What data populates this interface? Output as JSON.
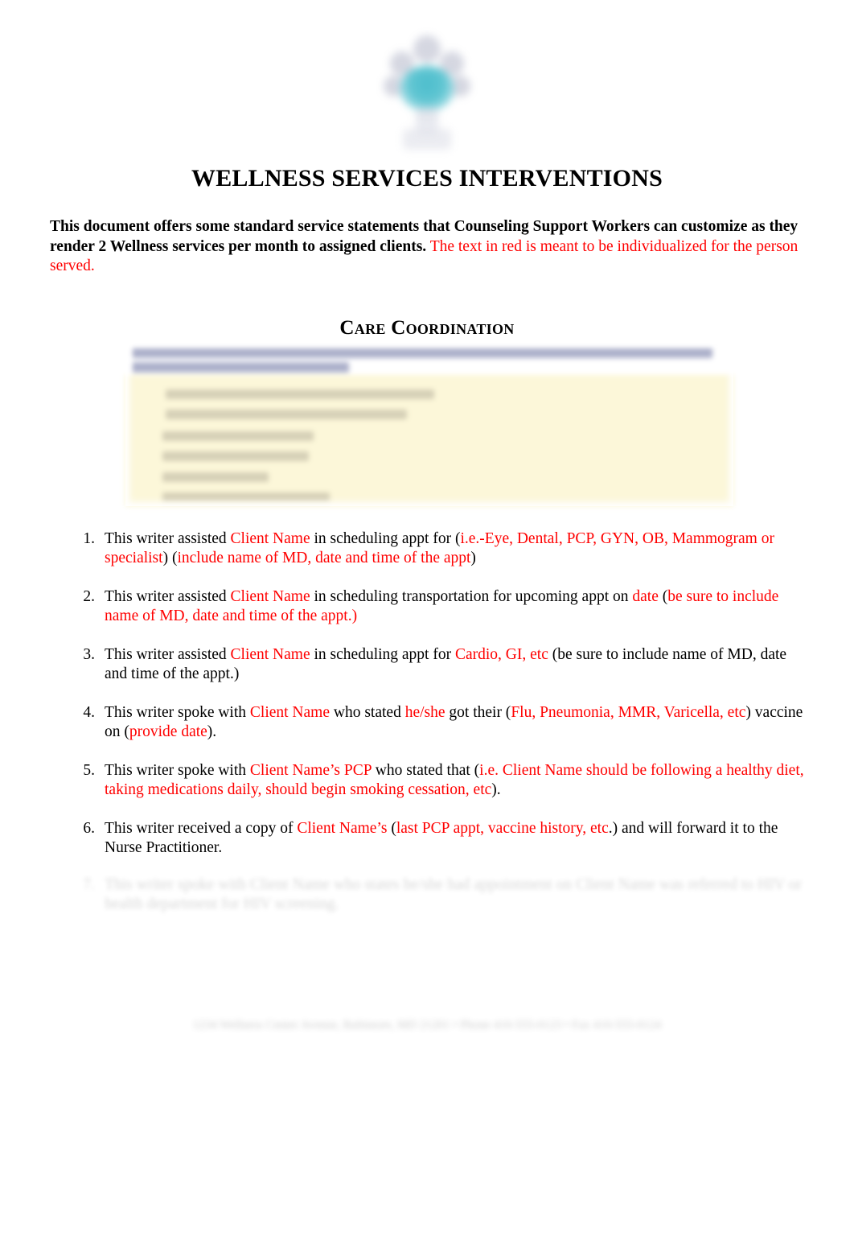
{
  "document": {
    "title": "WELLNESS SERVICES INTERVENTIONS",
    "logo_alt": "agency-logo",
    "intro": {
      "bold_black": "This document offers some standard service statements that Counseling Support Workers can customize as they render 2 Wellness services per month to assigned clients.",
      "red": "The text in red is meant to be individualized for the person served."
    },
    "section_heading": "Care Coordination",
    "callout": {
      "state": "redacted",
      "background_color": "#fcf7d9",
      "header_band_color": "#9ba0c0",
      "text": ""
    },
    "list": [
      {
        "number": "1.",
        "segments": [
          {
            "text": "This writer assisted ",
            "color": "black"
          },
          {
            "text": "Client Name",
            "color": "red"
          },
          {
            "text": " in scheduling appt for (",
            "color": "black"
          },
          {
            "text": "i.e.-Eye, Dental, PCP, GYN, OB, Mammogram or specialist",
            "color": "red"
          },
          {
            "text": ") (",
            "color": "black"
          },
          {
            "text": "include name of MD, date and time of the appt",
            "color": "red"
          },
          {
            "text": ")",
            "color": "black"
          }
        ]
      },
      {
        "number": "2.",
        "segments": [
          {
            "text": "This writer assisted ",
            "color": "black"
          },
          {
            "text": "Client Name",
            "color": "red"
          },
          {
            "text": " in scheduling transportation for upcoming appt on ",
            "color": "black"
          },
          {
            "text": "date",
            "color": "red"
          },
          {
            "text": " (",
            "color": "black"
          },
          {
            "text": "be sure to include name of MD, date and time of the appt.)",
            "color": "red"
          }
        ]
      },
      {
        "number": "3.",
        "segments": [
          {
            "text": "This writer assisted ",
            "color": "black"
          },
          {
            "text": "Client Name",
            "color": "red"
          },
          {
            "text": " in scheduling appt for ",
            "color": "black"
          },
          {
            "text": "Cardio, GI, etc",
            "color": "red"
          },
          {
            "text": " (be sure to include name of MD, date and time of the appt.)",
            "color": "black"
          }
        ]
      },
      {
        "number": "4.",
        "segments": [
          {
            "text": "This writer spoke with ",
            "color": "black"
          },
          {
            "text": "Client Name",
            "color": "red"
          },
          {
            "text": " who stated ",
            "color": "black"
          },
          {
            "text": "he/she",
            "color": "red"
          },
          {
            "text": " got their (",
            "color": "black"
          },
          {
            "text": "Flu, Pneumonia, MMR, Varicella, etc",
            "color": "red"
          },
          {
            "text": ") vaccine on (",
            "color": "black"
          },
          {
            "text": "provide date",
            "color": "red"
          },
          {
            "text": ").",
            "color": "black"
          }
        ]
      },
      {
        "number": "5.",
        "segments": [
          {
            "text": "This writer spoke with ",
            "color": "black"
          },
          {
            "text": "Client Name’s PCP",
            "color": "red"
          },
          {
            "text": " who stated that (",
            "color": "black"
          },
          {
            "text": "i.e. Client Name should be following a healthy diet, taking medications daily, should begin smoking cessation, etc",
            "color": "red"
          },
          {
            "text": ").",
            "color": "black"
          }
        ]
      },
      {
        "number": "6.",
        "segments": [
          {
            "text": "This writer received a copy of ",
            "color": "black"
          },
          {
            "text": "Client Name’s",
            "color": "red"
          },
          {
            "text": " (",
            "color": "black"
          },
          {
            "text": "last PCP appt, vaccine history, etc",
            "color": "red"
          },
          {
            "text": ".) and will forward it to the Nurse Practitioner.",
            "color": "black"
          }
        ]
      }
    ],
    "list_item_faded": {
      "number": "7.",
      "state": "blurred",
      "text": ""
    },
    "footer": {
      "state": "blurred",
      "text": ""
    },
    "colors": {
      "red_accent": "#FF0000",
      "text": "#000000",
      "callout_bg": "#fcf7d9",
      "logo_teal": "#2eb3c4"
    }
  }
}
